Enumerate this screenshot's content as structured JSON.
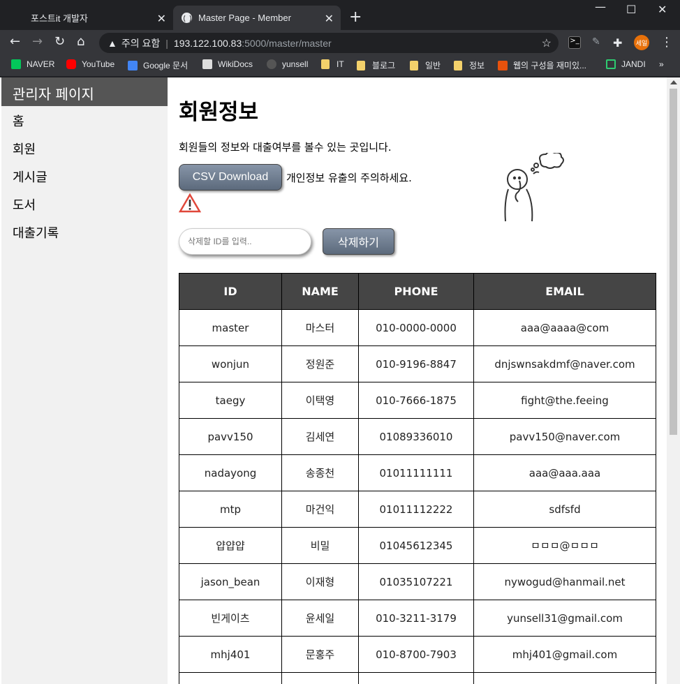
{
  "browser": {
    "tabs": [
      {
        "title": "포스트it 개발자"
      },
      {
        "title": "Master Page - Member"
      }
    ],
    "security_label": "주의 요함",
    "url_host": "193.122.100.83",
    "url_path": ":5000/master/master",
    "profile_label": "세일",
    "bookmarks": [
      "NAVER",
      "YouTube",
      "Google 문서",
      "WikiDocs",
      "yunsell",
      "IT",
      "블로그",
      "일반",
      "정보",
      "웹의 구성을 재미있...",
      "JANDI"
    ]
  },
  "sidebar": {
    "title": "관리자 페이지",
    "items": [
      "홈",
      "회원",
      "게시글",
      "도서",
      "대출기록"
    ]
  },
  "main": {
    "heading": "회원정보",
    "description": "회원들의 정보와 대출여부를 볼수 있는 곳입니다.",
    "csv_button": "CSV Download",
    "privacy_warning": "개인정보 유출의 주의하세요.",
    "delete_placeholder": "삭제할 ID를 입력..",
    "delete_button": "삭제하기"
  },
  "table": {
    "headers": [
      "ID",
      "NAME",
      "PHONE",
      "EMAIL"
    ],
    "rows": [
      [
        "master",
        "마스터",
        "010-0000-0000",
        "aaa@aaaa@com"
      ],
      [
        "wonjun",
        "정원준",
        "010-9196-8847",
        "dnjswnsakdmf@naver.com"
      ],
      [
        "taegy",
        "이택영",
        "010-7666-1875",
        "fight@the.feeing"
      ],
      [
        "pavv150",
        "김세연",
        "01089336010",
        "pavv150@naver.com"
      ],
      [
        "nadayong",
        "송종천",
        "01011111111",
        "aaa@aaa.aaa"
      ],
      [
        "mtp",
        "마건익",
        "01011112222",
        "sdfsfd"
      ],
      [
        "얍얍얍",
        "비밀",
        "01045612345",
        "ㅁㅁㅁ@ㅁㅁㅁ"
      ],
      [
        "jason_bean",
        "이재형",
        "01035107221",
        "nywogud@hanmail.net"
      ],
      [
        "빈게이츠",
        "윤세일",
        "010-3211-3179",
        "yunsell31@gmail.com"
      ],
      [
        "mhj401",
        "문홍주",
        "010-8700-7903",
        "mhj401@gmail.com"
      ],
      [
        "",
        "",
        "",
        ""
      ]
    ]
  }
}
